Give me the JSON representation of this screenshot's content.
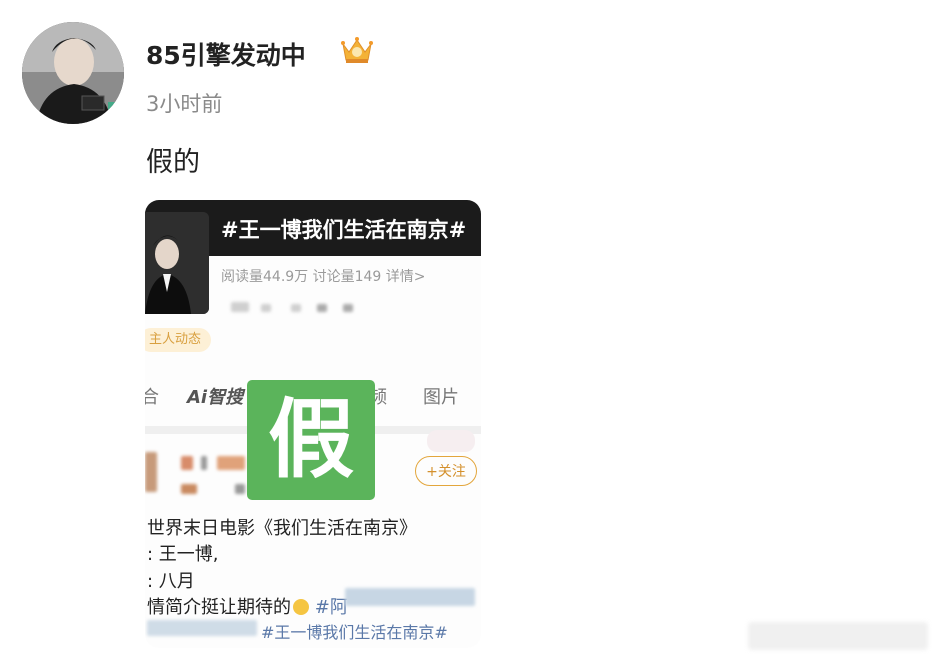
{
  "post": {
    "username": "85引擎发动中",
    "badge_icon": "crown-icon",
    "time": "3小时前",
    "text": "假的"
  },
  "card": {
    "topic_title": "#王一博我们生活在南京#",
    "stats": "阅读量44.9万  讨论量149  详情>",
    "tag_pill": "主人动态",
    "tabs": [
      "合",
      "Ai智搜",
      "频",
      "图片"
    ],
    "overlay_text": "假",
    "follow_label": "+关注",
    "lines": [
      "世界末日电影《我们生活在南京》",
      ": 王一博,",
      ": 八月",
      "情简介挺让期待的"
    ],
    "hashtag_partial": "#阿",
    "bottom_hashtag": "#王一博我们生活在南京#"
  },
  "colors": {
    "overlay_green": "#5bb45b",
    "follow_orange": "#e3a63c",
    "hashtag_blue": "#5a78a8"
  }
}
